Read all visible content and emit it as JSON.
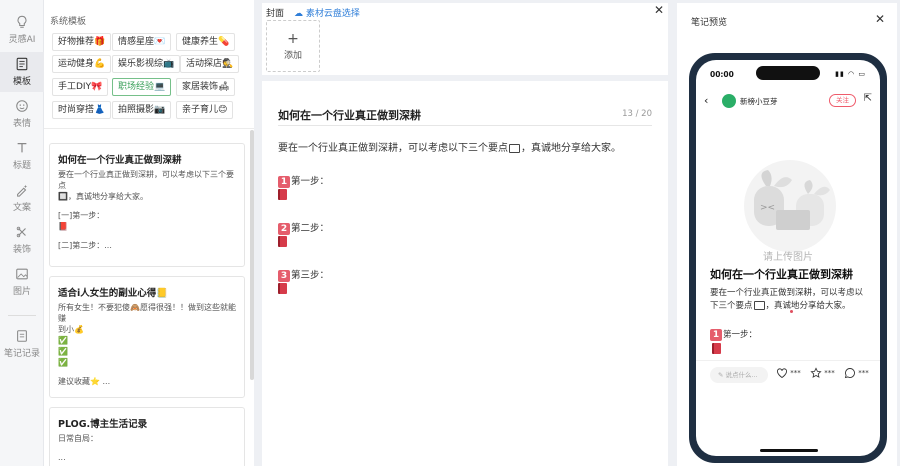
{
  "rail": {
    "items": [
      {
        "label": "灵感AI",
        "icon": "bulb-icon"
      },
      {
        "label": "模板",
        "icon": "template-icon"
      },
      {
        "label": "表情",
        "icon": "emoji-icon"
      },
      {
        "label": "标题",
        "icon": "text-icon"
      },
      {
        "label": "文案",
        "icon": "magic-pen-icon"
      },
      {
        "label": "装饰",
        "icon": "decor-icon"
      },
      {
        "label": "图片",
        "icon": "image-icon"
      },
      {
        "label": "笔记记录",
        "icon": "note-record-icon"
      }
    ]
  },
  "templates": {
    "title": "系统模板",
    "tags": [
      "好物推荐🎁",
      "情感星座💌",
      "健康养生💊",
      "运动健身💪",
      "娱乐影视综📺",
      "活动探店🕵",
      "手工DIY🎀",
      "职场经验💻",
      "家居装饰🛋",
      "时尚穿搭👗",
      "拍照摄影📷",
      "亲子育儿😊"
    ],
    "active_tag": "职场经验💻",
    "cards": [
      {
        "title": "如何在一个行业真正做到深耕",
        "lines": [
          "要在一个行业真正做到深耕，可以考虑以下三个要点",
          "🔲，真诚地分享给大家。",
          "",
          "[一]第一步：",
          "📕",
          "",
          "[二]第二步：..."
        ]
      },
      {
        "title": "适合i人女生的副业心得📒",
        "lines": [
          "所有女生！不要犯傻🙈愿得很强！！做到这些就能赚",
          "到小💰",
          "✅",
          "✅",
          "✅",
          "",
          "建议收藏⭐ ..."
        ]
      },
      {
        "title": "PLOG.博主生活记录",
        "lines": [
          "日常自局：",
          "",
          "..."
        ]
      }
    ]
  },
  "cover": {
    "label": "封面",
    "link": "素材云盘选择",
    "add": "添加"
  },
  "editor": {
    "title": "如何在一个行业真正做到深耕",
    "count": "13 / 20",
    "body_a": "要在一个行业真正做到深耕，可以考虑以下三个要点",
    "body_b": "，真诚地分享给大家。",
    "steps": [
      {
        "num": "1",
        "label": "第一步："
      },
      {
        "num": "2",
        "label": "第二步："
      },
      {
        "num": "3",
        "label": "第三步："
      }
    ]
  },
  "preview": {
    "title": "笔记预览",
    "time": "00:00",
    "user": "新榜小豆芽",
    "follow": "关注",
    "upload_hint": "请上传图片",
    "headline": "如何在一个行业真正做到深耕",
    "body_a": "要在一个行业真正做到深耕，可以考虑以下三个要点",
    "body_b": "，真诚地分享给大家。",
    "step1_num": "1",
    "step1": "第一步：",
    "comment_placeholder": "说点什么...",
    "like": "***",
    "collect": "***",
    "comments": "***"
  }
}
